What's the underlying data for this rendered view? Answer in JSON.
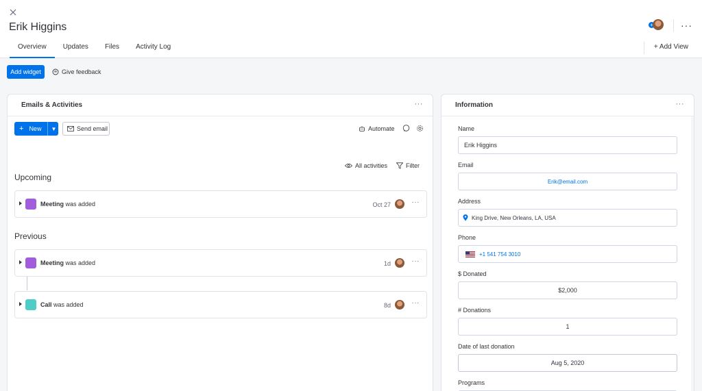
{
  "header": {
    "title": "Erik Higgins",
    "tabs": [
      {
        "label": "Overview"
      },
      {
        "label": "Updates"
      },
      {
        "label": "Files"
      },
      {
        "label": "Activity Log"
      }
    ],
    "add_view_label": "+ Add View",
    "more_label": "···"
  },
  "toolbar": {
    "add_widget_label": "Add widget",
    "give_feedback_label": "Give feedback"
  },
  "emails_panel": {
    "title": "Emails & Activities",
    "new_label": "New",
    "send_email_label": "Send email",
    "automate_label": "Automate",
    "all_activities_label": "All activities",
    "filter_label": "Filter",
    "upcoming_title": "Upcoming",
    "previous_title": "Previous",
    "upcoming": [
      {
        "type": "Meeting",
        "suffix": "was added",
        "date": "Oct 27"
      }
    ],
    "previous": [
      {
        "type": "Meeting",
        "suffix": "was added",
        "date": "1d"
      },
      {
        "type": "Call",
        "suffix": "was added",
        "date": "8d"
      }
    ]
  },
  "info_panel": {
    "title": "Information",
    "fields": {
      "name": {
        "label": "Name",
        "value": "Erik Higgins"
      },
      "email": {
        "label": "Email",
        "value": "Erik@email.com"
      },
      "address": {
        "label": "Address",
        "value": "King Drive, New Orleans, LA, USA"
      },
      "phone": {
        "label": "Phone",
        "value": "+1 541 754 3010"
      },
      "donated": {
        "label": "$ Donated",
        "value": "$2,000"
      },
      "donations": {
        "label": "# Donations",
        "value": "1"
      },
      "last_donation": {
        "label": "Date of last donation",
        "value": "Aug 5, 2020"
      },
      "programs": {
        "label": "Programs",
        "value": ""
      }
    }
  },
  "colors": {
    "primary": "#0073ea",
    "meeting": "#a25ddc",
    "call": "#4eccc6",
    "border": "#e1e3ea",
    "background": "#f5f6f8"
  }
}
